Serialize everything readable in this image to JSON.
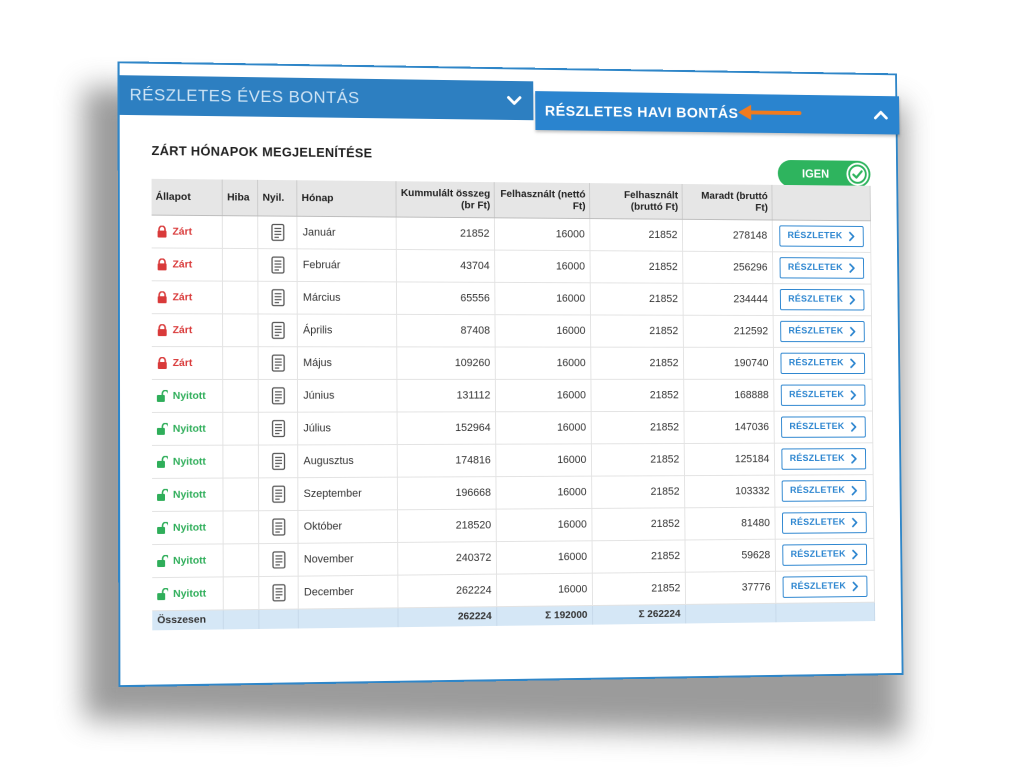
{
  "tabs": {
    "yearly_label": "RÉSZLETES ÉVES BONTÁS",
    "monthly_label": "RÉSZLETES HAVI BONTÁS"
  },
  "section": {
    "title": "ZÁRT HÓNAPOK MEGJELENÍTÉSE",
    "toggle_label": "IGEN"
  },
  "colors": {
    "accent": "#2a84cf",
    "closed": "#d93a3a",
    "open": "#2fae5a",
    "arrow": "#f07b1f"
  },
  "table": {
    "headers": {
      "status": "Állapot",
      "error": "Hiba",
      "open_col": "Nyil.",
      "month": "Hónap",
      "cumulative": "Kummulált összeg (br Ft)",
      "used_net": "Felhasznált (nettó Ft)",
      "used_gross": "Felhasznált (bruttó Ft)",
      "remaining": "Maradt (bruttó Ft)"
    },
    "button_label": "RÉSZLETEK",
    "rows": [
      {
        "status": "Zárt",
        "state": "closed",
        "month": "Január",
        "cumulative": "21852",
        "used_net": "16000",
        "used_gross": "21852",
        "remaining": "278148"
      },
      {
        "status": "Zárt",
        "state": "closed",
        "month": "Február",
        "cumulative": "43704",
        "used_net": "16000",
        "used_gross": "21852",
        "remaining": "256296"
      },
      {
        "status": "Zárt",
        "state": "closed",
        "month": "Március",
        "cumulative": "65556",
        "used_net": "16000",
        "used_gross": "21852",
        "remaining": "234444"
      },
      {
        "status": "Zárt",
        "state": "closed",
        "month": "Április",
        "cumulative": "87408",
        "used_net": "16000",
        "used_gross": "21852",
        "remaining": "212592"
      },
      {
        "status": "Zárt",
        "state": "closed",
        "month": "Május",
        "cumulative": "109260",
        "used_net": "16000",
        "used_gross": "21852",
        "remaining": "190740"
      },
      {
        "status": "Nyitott",
        "state": "open",
        "month": "Június",
        "cumulative": "131112",
        "used_net": "16000",
        "used_gross": "21852",
        "remaining": "168888"
      },
      {
        "status": "Nyitott",
        "state": "open",
        "month": "Július",
        "cumulative": "152964",
        "used_net": "16000",
        "used_gross": "21852",
        "remaining": "147036"
      },
      {
        "status": "Nyitott",
        "state": "open",
        "month": "Augusztus",
        "cumulative": "174816",
        "used_net": "16000",
        "used_gross": "21852",
        "remaining": "125184"
      },
      {
        "status": "Nyitott",
        "state": "open",
        "month": "Szeptember",
        "cumulative": "196668",
        "used_net": "16000",
        "used_gross": "21852",
        "remaining": "103332"
      },
      {
        "status": "Nyitott",
        "state": "open",
        "month": "Október",
        "cumulative": "218520",
        "used_net": "16000",
        "used_gross": "21852",
        "remaining": "81480"
      },
      {
        "status": "Nyitott",
        "state": "open",
        "month": "November",
        "cumulative": "240372",
        "used_net": "16000",
        "used_gross": "21852",
        "remaining": "59628"
      },
      {
        "status": "Nyitott",
        "state": "open",
        "month": "December",
        "cumulative": "262224",
        "used_net": "16000",
        "used_gross": "21852",
        "remaining": "37776"
      }
    ],
    "footer": {
      "label": "Összesen",
      "cumulative": "262224",
      "used_net": "Σ 192000",
      "used_gross": "Σ 262224"
    }
  }
}
